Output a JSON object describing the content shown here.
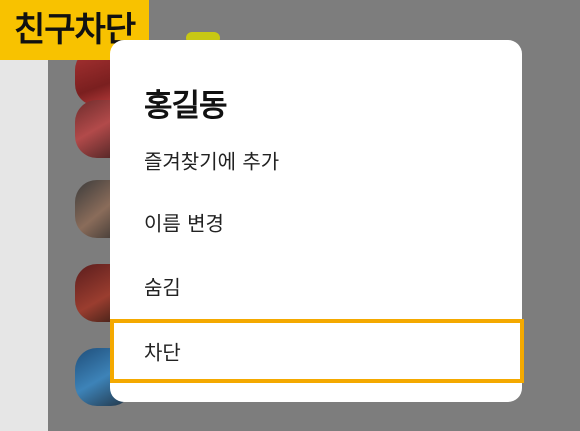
{
  "caption": "친구차단",
  "dialog": {
    "title": "홍길동",
    "items": [
      {
        "label": "즐겨찾기에 추가"
      },
      {
        "label": "이름 변경"
      },
      {
        "label": "숨김"
      },
      {
        "label": "차단"
      }
    ]
  },
  "colors": {
    "highlight": "#f4a900",
    "caption_bg": "#f8c200",
    "overlay": "#7d7d7d"
  }
}
